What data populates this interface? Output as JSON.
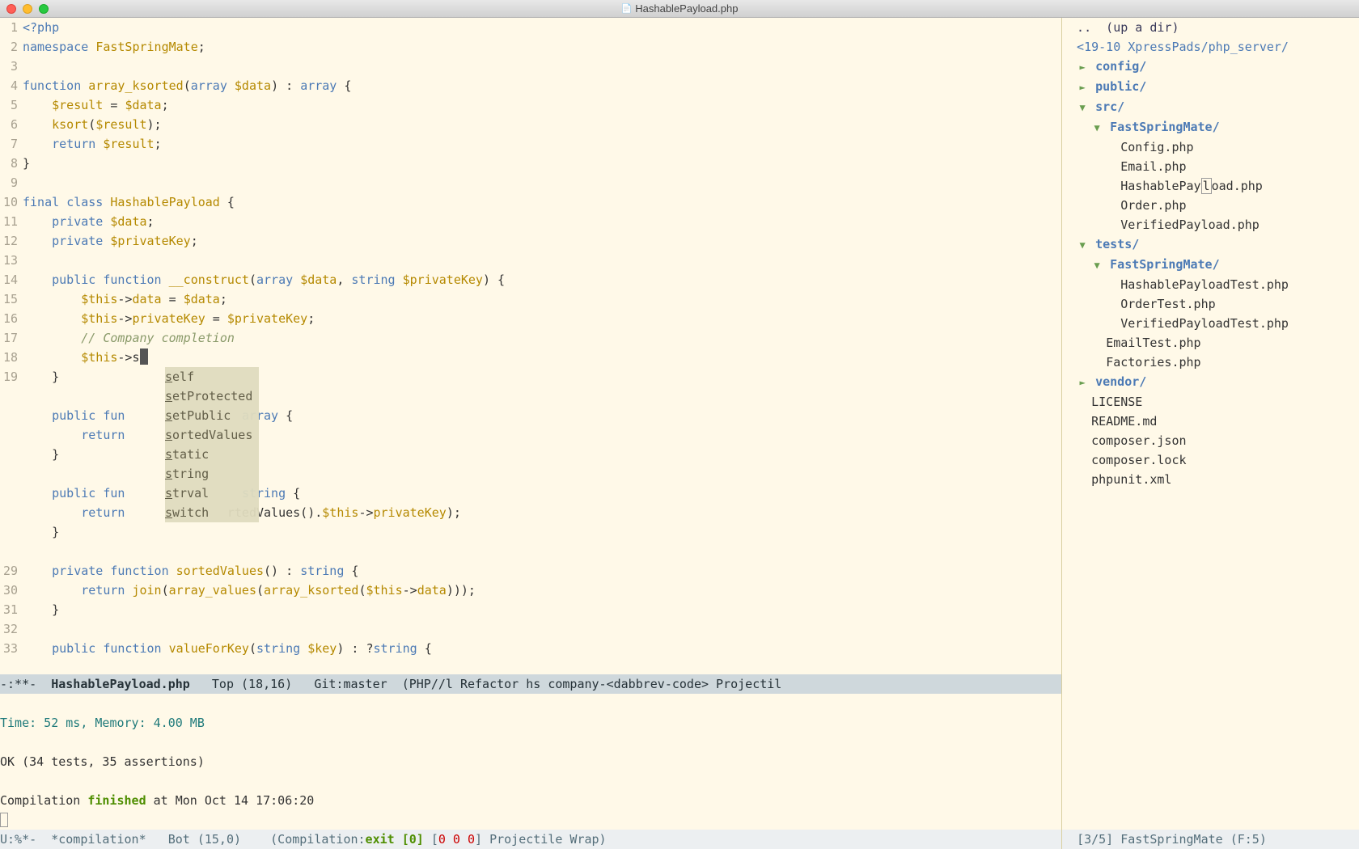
{
  "titlebar": {
    "filename": "HashablePayload.php"
  },
  "editor": {
    "filename": "HashablePayload.php",
    "line_numbers": [
      "1",
      "2",
      "3",
      "4",
      "5",
      "6",
      "7",
      "8",
      "9",
      "10",
      "11",
      "12",
      "13",
      "14",
      "15",
      "16",
      "17",
      "18",
      "19",
      "",
      "",
      "",
      "",
      "",
      "",
      "",
      "",
      "",
      "29",
      "30",
      "31",
      "32",
      "33"
    ],
    "comment17": "// Company completion",
    "completion_items": [
      "self",
      "setProtected",
      "setPublic",
      "sortedValues",
      "static",
      "string",
      "strval",
      "switch"
    ]
  },
  "modeline_main": {
    "prefix": "-:**- ",
    "file": " HashablePayload.php ",
    "pos": "  Top (18,16)   ",
    "vc": "Git:master",
    "modes": "  (PHP//l Refactor hs company-<dabbrev-code> Projectil"
  },
  "compilation": {
    "time_line": "Time: 52 ms, Memory: 4.00 MB",
    "ok_line": "OK (34 tests, 35 assertions)",
    "finished_prefix": "Compilation ",
    "finished_word": "finished",
    "finished_suffix": " at Mon Oct 14 17:06:20"
  },
  "modeline_comp": {
    "text": "U:%*-  *compilation*   Bot (15,0)    (Compilation:",
    "exit": "exit [0]",
    "brackets": " [0 0 0]",
    "rest": " Projectile Wrap)"
  },
  "dired": {
    "up": "..  (up a dir)",
    "root": "<19-10 XpressPads/php_server/",
    "items": [
      {
        "depth": 0,
        "icon": "►",
        "label": "config/",
        "type": "dir"
      },
      {
        "depth": 0,
        "icon": "►",
        "label": "public/",
        "type": "dir"
      },
      {
        "depth": 0,
        "icon": "▼",
        "label": "src/",
        "type": "dir"
      },
      {
        "depth": 1,
        "icon": "▼",
        "label": "FastSpringMate/",
        "type": "dir"
      },
      {
        "depth": 2,
        "icon": "",
        "label": "Config.php",
        "type": "file"
      },
      {
        "depth": 2,
        "icon": "",
        "label": "Email.php",
        "type": "file"
      },
      {
        "depth": 2,
        "icon": "",
        "label": "HashablePayload.php",
        "type": "file",
        "current": true
      },
      {
        "depth": 2,
        "icon": "",
        "label": "Order.php",
        "type": "file"
      },
      {
        "depth": 2,
        "icon": "",
        "label": "VerifiedPayload.php",
        "type": "file"
      },
      {
        "depth": 0,
        "icon": "▼",
        "label": "tests/",
        "type": "dir"
      },
      {
        "depth": 1,
        "icon": "▼",
        "label": "FastSpringMate/",
        "type": "dir"
      },
      {
        "depth": 2,
        "icon": "",
        "label": "HashablePayloadTest.php",
        "type": "file"
      },
      {
        "depth": 2,
        "icon": "",
        "label": "OrderTest.php",
        "type": "file"
      },
      {
        "depth": 2,
        "icon": "",
        "label": "VerifiedPayloadTest.php",
        "type": "file"
      },
      {
        "depth": 1,
        "icon": "",
        "label": "EmailTest.php",
        "type": "file"
      },
      {
        "depth": 1,
        "icon": "",
        "label": "Factories.php",
        "type": "file"
      },
      {
        "depth": 0,
        "icon": "►",
        "label": "vendor/",
        "type": "dir"
      },
      {
        "depth": 0,
        "icon": "",
        "label": "LICENSE",
        "type": "file"
      },
      {
        "depth": 0,
        "icon": "",
        "label": "README.md",
        "type": "file"
      },
      {
        "depth": 0,
        "icon": "",
        "label": "composer.json",
        "type": "file"
      },
      {
        "depth": 0,
        "icon": "",
        "label": "composer.lock",
        "type": "file"
      },
      {
        "depth": 0,
        "icon": "",
        "label": "phpunit.xml",
        "type": "file"
      }
    ]
  },
  "modeline_dired": {
    "text": "[3/5] FastSpringMate (F:5)"
  }
}
